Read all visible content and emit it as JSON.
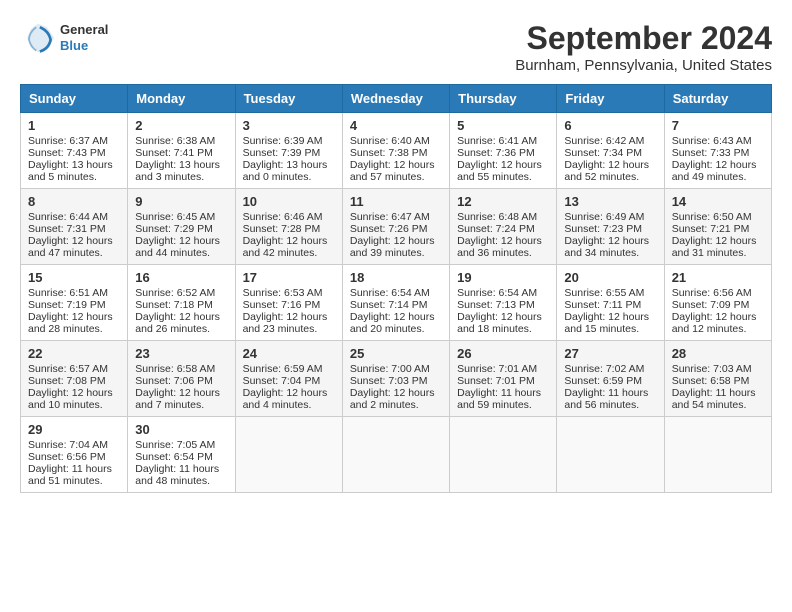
{
  "header": {
    "logo_line1": "General",
    "logo_line2": "Blue",
    "title": "September 2024",
    "subtitle": "Burnham, Pennsylvania, United States"
  },
  "weekdays": [
    "Sunday",
    "Monday",
    "Tuesday",
    "Wednesday",
    "Thursday",
    "Friday",
    "Saturday"
  ],
  "weeks": [
    [
      {
        "day": 1,
        "lines": [
          "Sunrise: 6:37 AM",
          "Sunset: 7:43 PM",
          "Daylight: 13 hours",
          "and 5 minutes."
        ]
      },
      {
        "day": 2,
        "lines": [
          "Sunrise: 6:38 AM",
          "Sunset: 7:41 PM",
          "Daylight: 13 hours",
          "and 3 minutes."
        ]
      },
      {
        "day": 3,
        "lines": [
          "Sunrise: 6:39 AM",
          "Sunset: 7:39 PM",
          "Daylight: 13 hours",
          "and 0 minutes."
        ]
      },
      {
        "day": 4,
        "lines": [
          "Sunrise: 6:40 AM",
          "Sunset: 7:38 PM",
          "Daylight: 12 hours",
          "and 57 minutes."
        ]
      },
      {
        "day": 5,
        "lines": [
          "Sunrise: 6:41 AM",
          "Sunset: 7:36 PM",
          "Daylight: 12 hours",
          "and 55 minutes."
        ]
      },
      {
        "day": 6,
        "lines": [
          "Sunrise: 6:42 AM",
          "Sunset: 7:34 PM",
          "Daylight: 12 hours",
          "and 52 minutes."
        ]
      },
      {
        "day": 7,
        "lines": [
          "Sunrise: 6:43 AM",
          "Sunset: 7:33 PM",
          "Daylight: 12 hours",
          "and 49 minutes."
        ]
      }
    ],
    [
      {
        "day": 8,
        "lines": [
          "Sunrise: 6:44 AM",
          "Sunset: 7:31 PM",
          "Daylight: 12 hours",
          "and 47 minutes."
        ]
      },
      {
        "day": 9,
        "lines": [
          "Sunrise: 6:45 AM",
          "Sunset: 7:29 PM",
          "Daylight: 12 hours",
          "and 44 minutes."
        ]
      },
      {
        "day": 10,
        "lines": [
          "Sunrise: 6:46 AM",
          "Sunset: 7:28 PM",
          "Daylight: 12 hours",
          "and 42 minutes."
        ]
      },
      {
        "day": 11,
        "lines": [
          "Sunrise: 6:47 AM",
          "Sunset: 7:26 PM",
          "Daylight: 12 hours",
          "and 39 minutes."
        ]
      },
      {
        "day": 12,
        "lines": [
          "Sunrise: 6:48 AM",
          "Sunset: 7:24 PM",
          "Daylight: 12 hours",
          "and 36 minutes."
        ]
      },
      {
        "day": 13,
        "lines": [
          "Sunrise: 6:49 AM",
          "Sunset: 7:23 PM",
          "Daylight: 12 hours",
          "and 34 minutes."
        ]
      },
      {
        "day": 14,
        "lines": [
          "Sunrise: 6:50 AM",
          "Sunset: 7:21 PM",
          "Daylight: 12 hours",
          "and 31 minutes."
        ]
      }
    ],
    [
      {
        "day": 15,
        "lines": [
          "Sunrise: 6:51 AM",
          "Sunset: 7:19 PM",
          "Daylight: 12 hours",
          "and 28 minutes."
        ]
      },
      {
        "day": 16,
        "lines": [
          "Sunrise: 6:52 AM",
          "Sunset: 7:18 PM",
          "Daylight: 12 hours",
          "and 26 minutes."
        ]
      },
      {
        "day": 17,
        "lines": [
          "Sunrise: 6:53 AM",
          "Sunset: 7:16 PM",
          "Daylight: 12 hours",
          "and 23 minutes."
        ]
      },
      {
        "day": 18,
        "lines": [
          "Sunrise: 6:54 AM",
          "Sunset: 7:14 PM",
          "Daylight: 12 hours",
          "and 20 minutes."
        ]
      },
      {
        "day": 19,
        "lines": [
          "Sunrise: 6:54 AM",
          "Sunset: 7:13 PM",
          "Daylight: 12 hours",
          "and 18 minutes."
        ]
      },
      {
        "day": 20,
        "lines": [
          "Sunrise: 6:55 AM",
          "Sunset: 7:11 PM",
          "Daylight: 12 hours",
          "and 15 minutes."
        ]
      },
      {
        "day": 21,
        "lines": [
          "Sunrise: 6:56 AM",
          "Sunset: 7:09 PM",
          "Daylight: 12 hours",
          "and 12 minutes."
        ]
      }
    ],
    [
      {
        "day": 22,
        "lines": [
          "Sunrise: 6:57 AM",
          "Sunset: 7:08 PM",
          "Daylight: 12 hours",
          "and 10 minutes."
        ]
      },
      {
        "day": 23,
        "lines": [
          "Sunrise: 6:58 AM",
          "Sunset: 7:06 PM",
          "Daylight: 12 hours",
          "and 7 minutes."
        ]
      },
      {
        "day": 24,
        "lines": [
          "Sunrise: 6:59 AM",
          "Sunset: 7:04 PM",
          "Daylight: 12 hours",
          "and 4 minutes."
        ]
      },
      {
        "day": 25,
        "lines": [
          "Sunrise: 7:00 AM",
          "Sunset: 7:03 PM",
          "Daylight: 12 hours",
          "and 2 minutes."
        ]
      },
      {
        "day": 26,
        "lines": [
          "Sunrise: 7:01 AM",
          "Sunset: 7:01 PM",
          "Daylight: 11 hours",
          "and 59 minutes."
        ]
      },
      {
        "day": 27,
        "lines": [
          "Sunrise: 7:02 AM",
          "Sunset: 6:59 PM",
          "Daylight: 11 hours",
          "and 56 minutes."
        ]
      },
      {
        "day": 28,
        "lines": [
          "Sunrise: 7:03 AM",
          "Sunset: 6:58 PM",
          "Daylight: 11 hours",
          "and 54 minutes."
        ]
      }
    ],
    [
      {
        "day": 29,
        "lines": [
          "Sunrise: 7:04 AM",
          "Sunset: 6:56 PM",
          "Daylight: 11 hours",
          "and 51 minutes."
        ]
      },
      {
        "day": 30,
        "lines": [
          "Sunrise: 7:05 AM",
          "Sunset: 6:54 PM",
          "Daylight: 11 hours",
          "and 48 minutes."
        ]
      },
      null,
      null,
      null,
      null,
      null
    ]
  ]
}
